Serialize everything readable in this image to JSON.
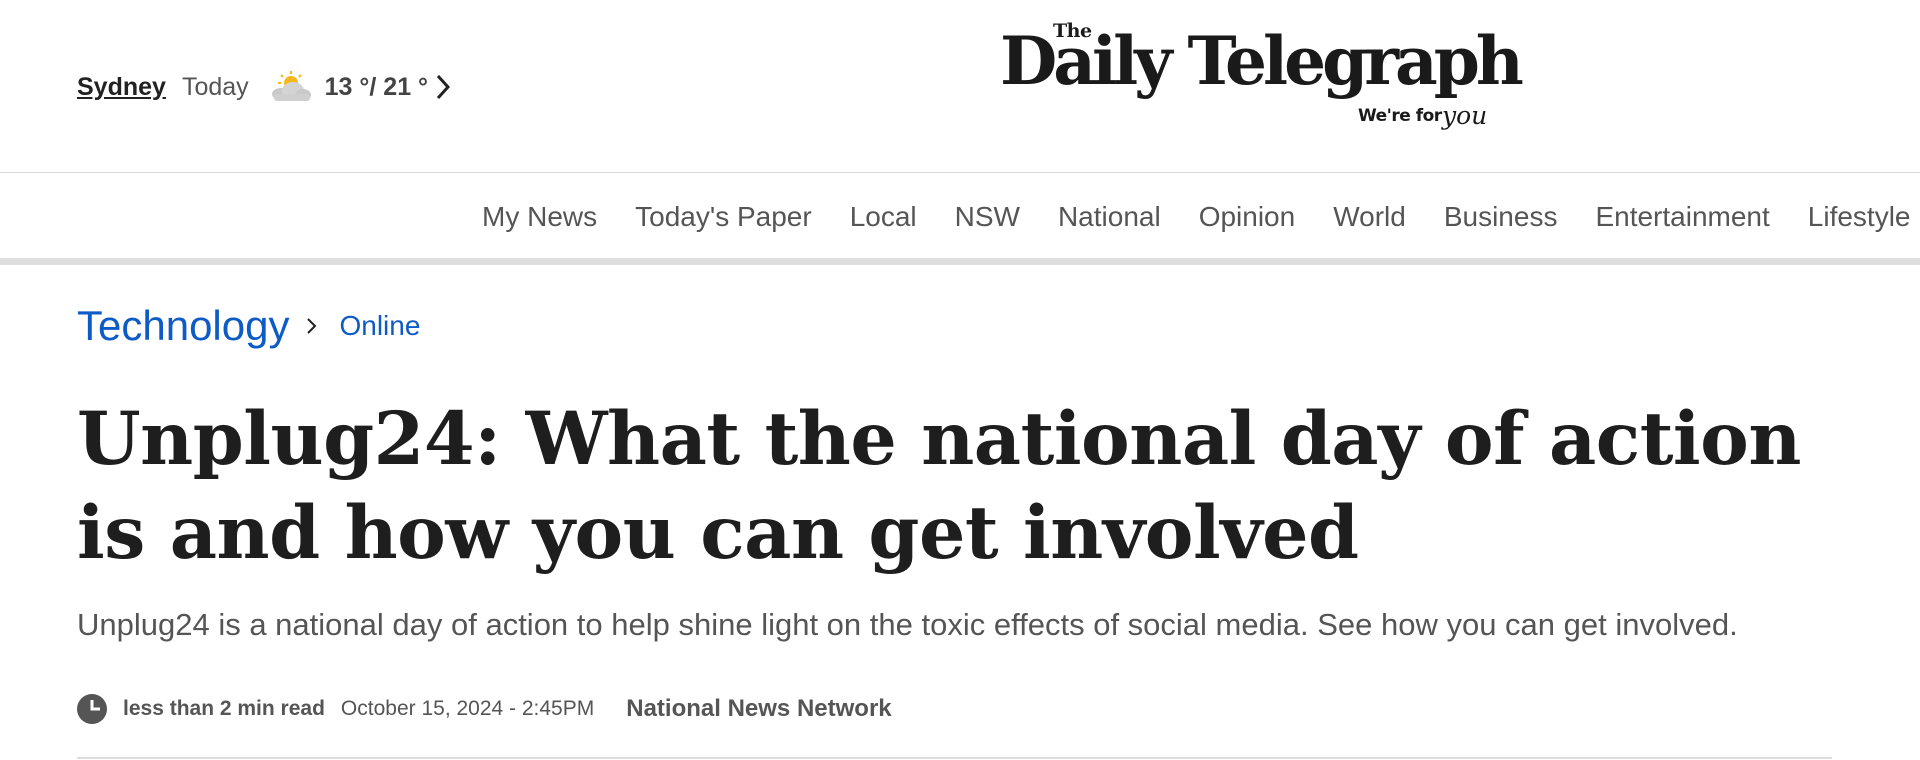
{
  "weather": {
    "city": "Sydney",
    "day": "Today",
    "icon": "partly-sunny-icon",
    "temps": "13 °/ 21 °"
  },
  "masthead": {
    "the": "The",
    "name": "Daily Telegraph",
    "tagline_prefix": "We're for",
    "tagline_script": "you"
  },
  "nav": {
    "items": [
      "My News",
      "Today's Paper",
      "Local",
      "NSW",
      "National",
      "Opinion",
      "World",
      "Business",
      "Entertainment",
      "Lifestyle"
    ]
  },
  "article": {
    "section": "Technology",
    "subsection": "Online",
    "headline": "Unplug24: What the national day of action is and how you can get involved",
    "standfirst": "Unplug24 is a national day of action to help shine light on the toxic effects of social media. See how you can get involved.",
    "read_time": "less than 2 min read",
    "date": "October 15, 2024 - 2:45PM",
    "author": "National News Network"
  },
  "colors": {
    "link_blue": "#0d5bc6",
    "text_dark": "#1e1e1e",
    "text_grey": "#555555"
  }
}
